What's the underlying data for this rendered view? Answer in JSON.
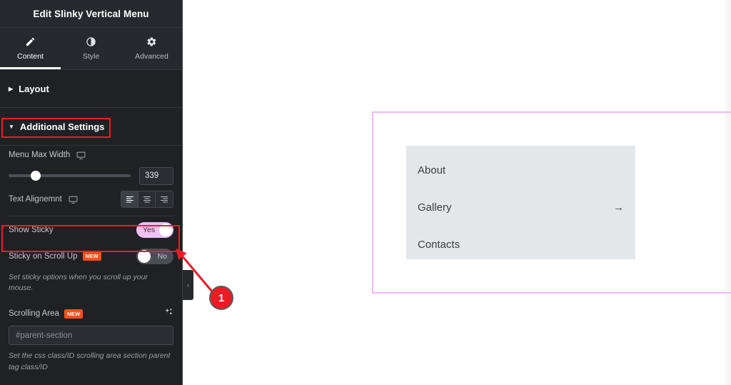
{
  "panel": {
    "title": "Edit Slinky Vertical Menu",
    "tabs": [
      {
        "label": "Content",
        "icon": "pencil-icon",
        "active": true
      },
      {
        "label": "Style",
        "icon": "contrast-icon",
        "active": false
      },
      {
        "label": "Advanced",
        "icon": "gear-icon",
        "active": false
      }
    ],
    "sections": [
      {
        "label": "Layout",
        "expanded": false
      },
      {
        "label": "Additional Settings",
        "expanded": true
      }
    ],
    "controls": {
      "menu_max_width": {
        "label": "Menu Max Width",
        "device_icon": "desktop-icon",
        "value": "339",
        "slider_percent": 22
      },
      "text_alignment": {
        "label": "Text Alignemnt",
        "device_icon": "desktop-icon",
        "options": [
          "align-left",
          "align-center",
          "align-right"
        ],
        "selected": "align-left"
      },
      "show_sticky": {
        "label": "Show Sticky",
        "state": "Yes",
        "on": true
      },
      "sticky_on_scroll_up": {
        "label": "Sticky on Scroll Up",
        "badge": "NEW",
        "state": "No",
        "on": false,
        "hint": "Set sticky options when you scroll up your mouse."
      },
      "scrolling_area": {
        "label": "Scrolling Area",
        "badge": "NEW",
        "ai_icon": "sparkle-icon",
        "placeholder": "#parent-section",
        "value": "",
        "hint": "Set the css class/ID scrolling area section parent tag class/ID"
      }
    }
  },
  "canvas": {
    "collapse_handle": "‹",
    "menu": {
      "items": [
        {
          "label": "About",
          "arrow": ""
        },
        {
          "label": "Gallery",
          "arrow": "→"
        },
        {
          "label": "Contacts",
          "arrow": ""
        }
      ]
    }
  },
  "annotations": {
    "step_badge": "1"
  },
  "colors": {
    "panel_bg": "#1f2124",
    "panel_header_bg": "#26292d",
    "accent_toggle_on": "#eec0f5",
    "badge_new": "#f4501e",
    "annotation_red": "#ed1c24",
    "section_guide": "#f3b8f6",
    "menu_bg": "#e3e7ea"
  }
}
